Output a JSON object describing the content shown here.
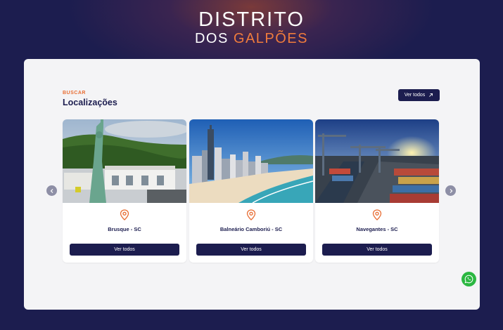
{
  "brand": {
    "line1": "DISTRITO",
    "line2_a": "DOS ",
    "line2_b": "GALPÕES",
    "accent_color": "#f07c3c",
    "navy": "#1c1d4f"
  },
  "section": {
    "eyebrow": "BUSCAR",
    "title": "Localizações",
    "see_all_label": "Ver todos"
  },
  "cards": [
    {
      "name": "Brusque - SC",
      "button": "Ver todos",
      "image": "statue-of-liberty-store-photo"
    },
    {
      "name": "Balneário Camboriú - SC",
      "button": "Ver todos",
      "image": "beach-skyline-photo"
    },
    {
      "name": "Navegantes - SC",
      "button": "Ver todos",
      "image": "port-cranes-photo"
    }
  ],
  "icons": {
    "prev": "chevron-left-icon",
    "next": "chevron-right-icon",
    "pin": "location-pin-icon",
    "whatsapp": "whatsapp-icon"
  }
}
